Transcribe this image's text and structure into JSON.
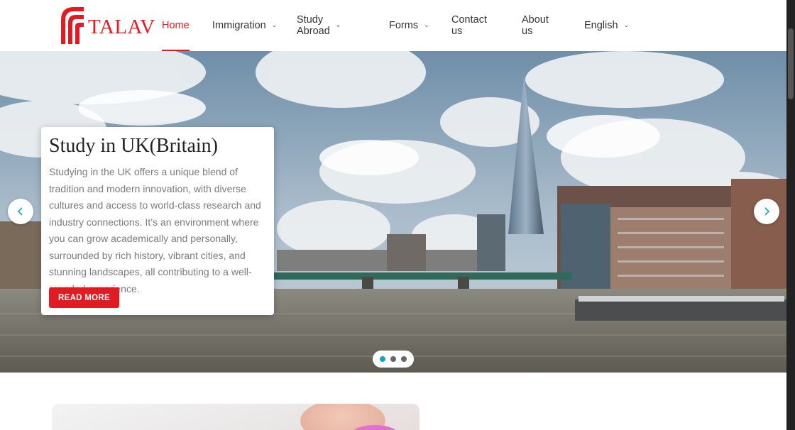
{
  "brand": {
    "name": "TALAV",
    "color": "#e21b23"
  },
  "nav": {
    "home": "Home",
    "immigration": "Immigration",
    "study_abroad": "Study Abroad",
    "forms": "Forms",
    "contact": "Contact us",
    "about": "About us",
    "language": "English",
    "active": "Home"
  },
  "slider": {
    "title": "Study in UK(Britain)",
    "description": "Studying in the UK offers a unique blend of tradition and modern innovation, with diverse cultures and access to world-class research and industry connections. It’s an environment where you can grow academically and personally, surrounded by rich history, vibrant cities, and stunning landscapes, all contributing to a well-rounded experience.",
    "button": "READ MORE",
    "slide_count": 3,
    "active_slide": 1,
    "accent_dot": "#1aa3c1"
  },
  "icons": {
    "prev": "chevron-left-icon",
    "next": "chevron-right-icon",
    "dropdown": "chevron-down-icon"
  }
}
